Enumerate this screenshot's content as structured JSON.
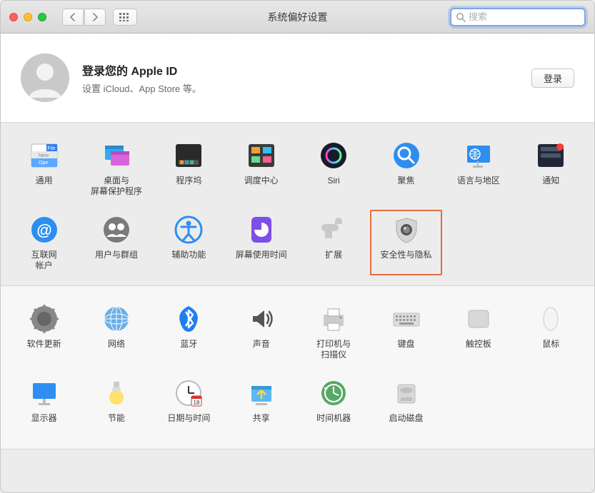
{
  "window": {
    "title": "系统偏好设置"
  },
  "search": {
    "placeholder": "搜索"
  },
  "appleid": {
    "heading": "登录您的 Apple ID",
    "subtitle": "设置 iCloud、App Store 等。",
    "signin": "登录"
  },
  "row1": [
    {
      "key": "general",
      "label": "通用"
    },
    {
      "key": "desktop",
      "label": "桌面与\n屏幕保护程序"
    },
    {
      "key": "dock",
      "label": "程序坞"
    },
    {
      "key": "mission",
      "label": "调度中心"
    },
    {
      "key": "siri",
      "label": "Siri"
    },
    {
      "key": "spotlight",
      "label": "聚焦"
    },
    {
      "key": "language",
      "label": "语言与地区"
    },
    {
      "key": "notifications",
      "label": "通知"
    }
  ],
  "row2": [
    {
      "key": "internet",
      "label": "互联网\n帐户"
    },
    {
      "key": "users",
      "label": "用户与群组"
    },
    {
      "key": "accessibility",
      "label": "辅助功能"
    },
    {
      "key": "screentime",
      "label": "屏幕使用时间"
    },
    {
      "key": "extensions",
      "label": "扩展"
    },
    {
      "key": "security",
      "label": "安全性与隐私",
      "highlight": true
    }
  ],
  "row3": [
    {
      "key": "update",
      "label": "软件更新"
    },
    {
      "key": "network",
      "label": "网络"
    },
    {
      "key": "bluetooth",
      "label": "蓝牙"
    },
    {
      "key": "sound",
      "label": "声音"
    },
    {
      "key": "printers",
      "label": "打印机与\n扫描仪"
    },
    {
      "key": "keyboard",
      "label": "键盘"
    },
    {
      "key": "trackpad",
      "label": "触控板"
    },
    {
      "key": "mouse",
      "label": "鼠标"
    }
  ],
  "row4": [
    {
      "key": "displays",
      "label": "显示器"
    },
    {
      "key": "energy",
      "label": "节能"
    },
    {
      "key": "datetime",
      "label": "日期与时间"
    },
    {
      "key": "sharing",
      "label": "共享"
    },
    {
      "key": "timemachine",
      "label": "时间机器"
    },
    {
      "key": "startup",
      "label": "启动磁盘"
    }
  ]
}
